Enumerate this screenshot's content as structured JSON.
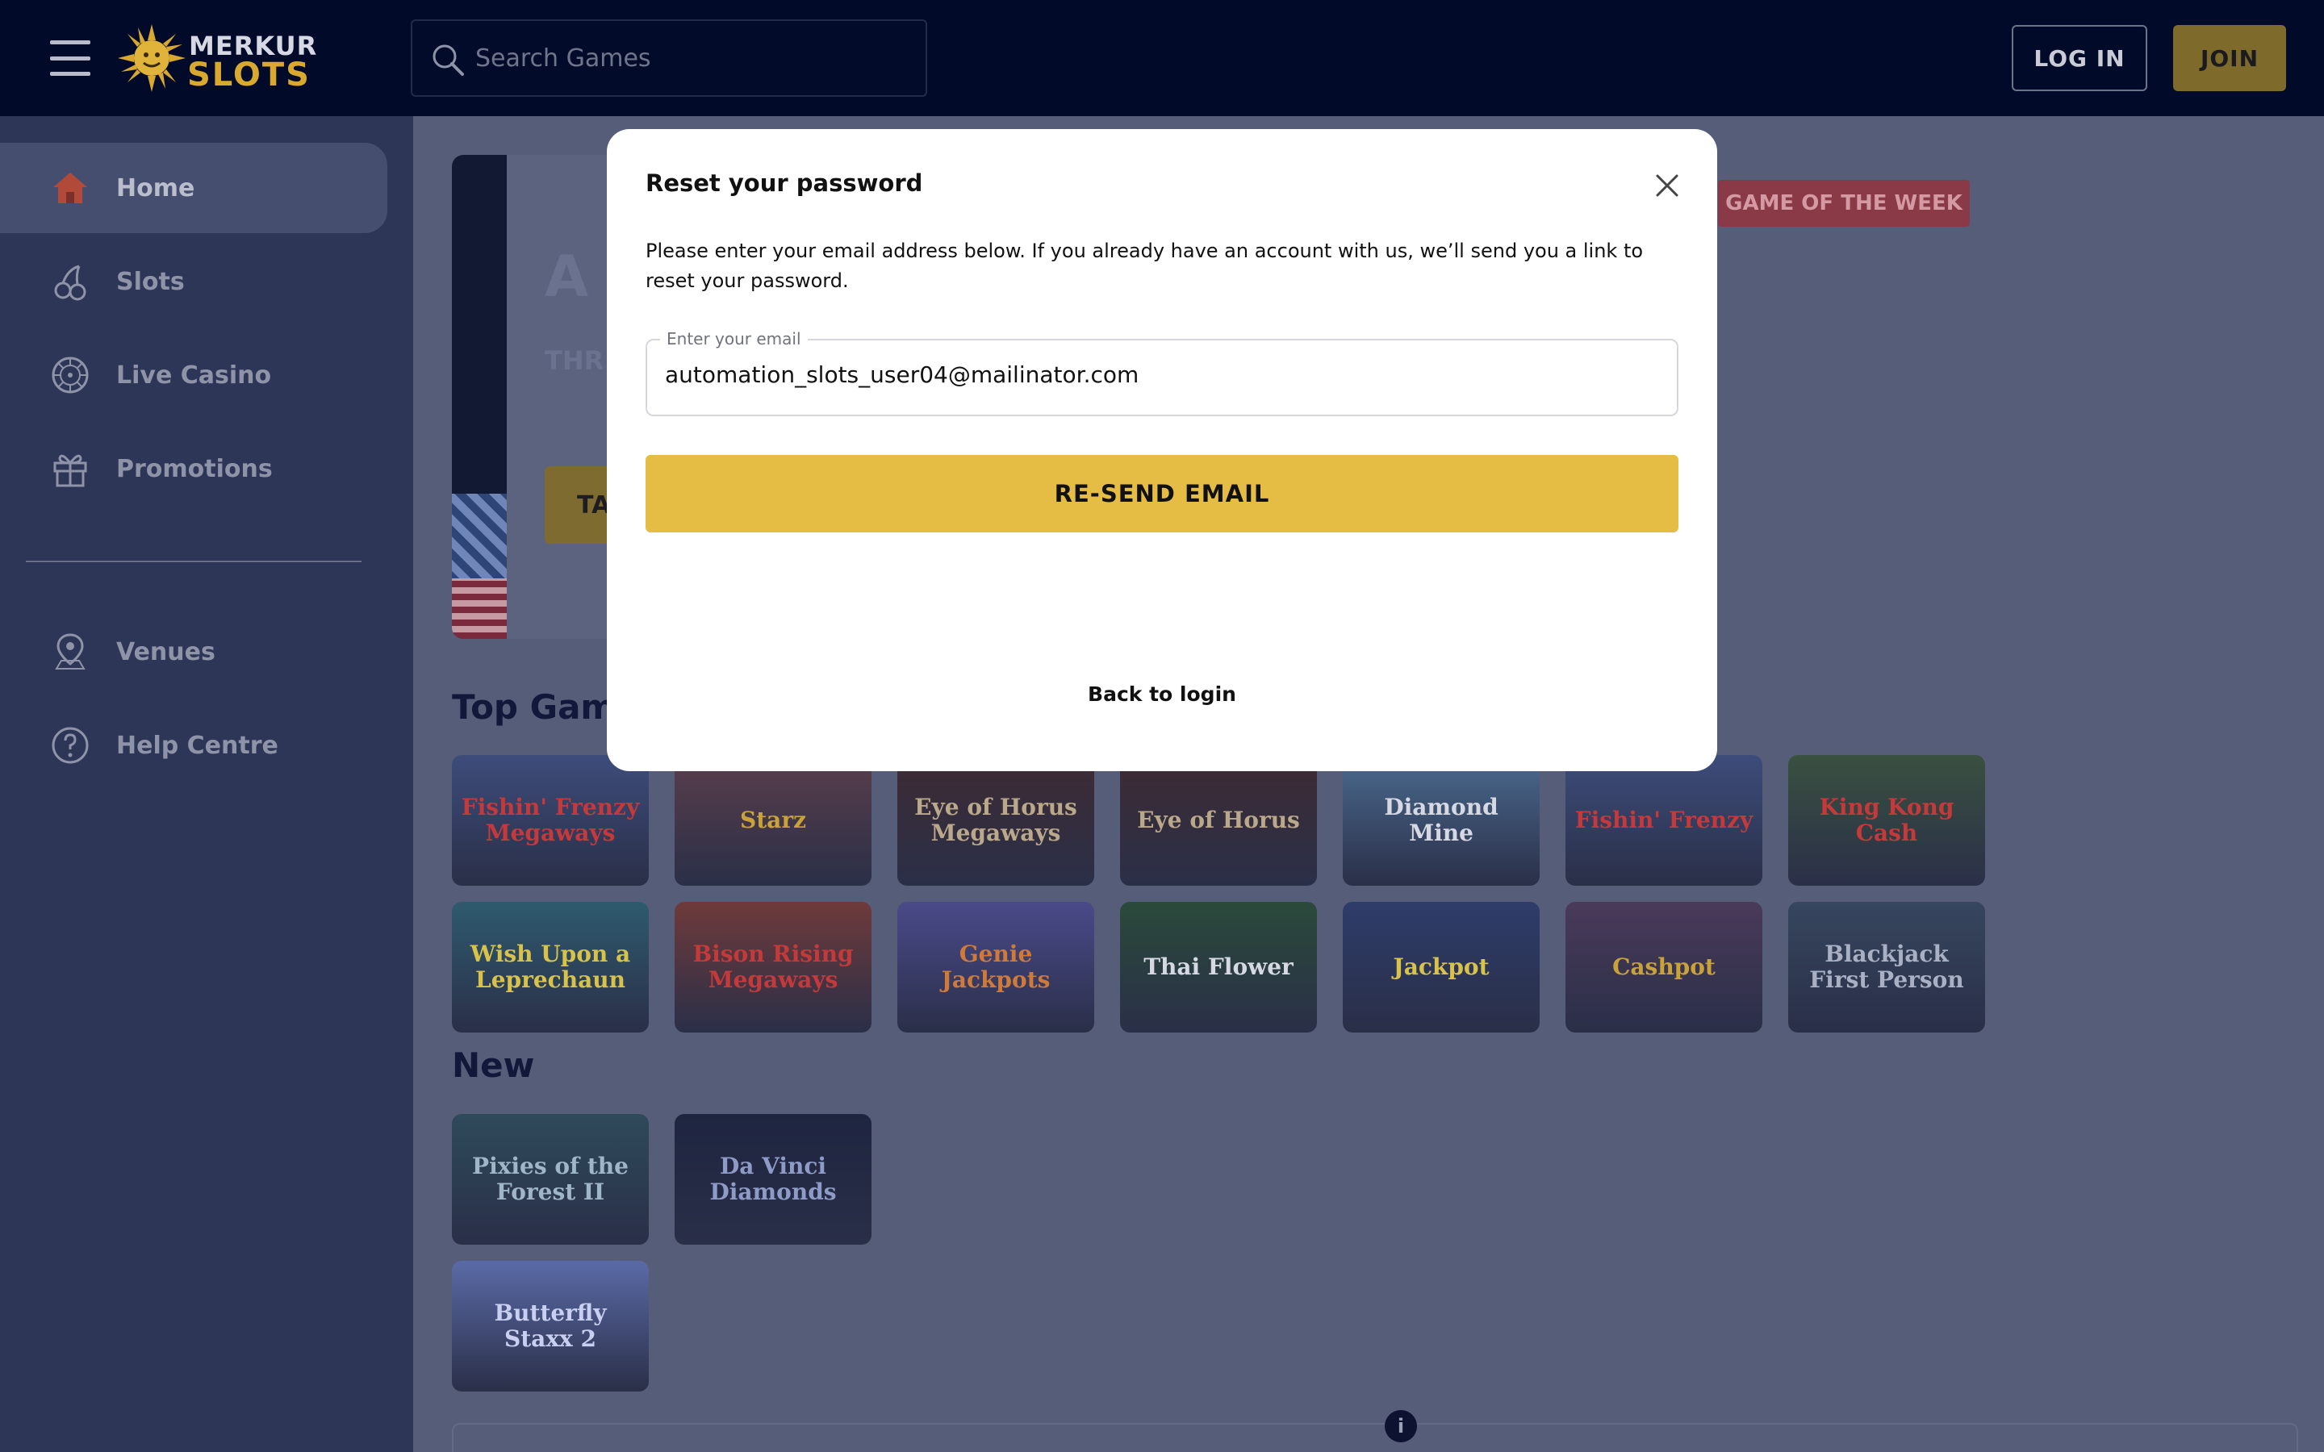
{
  "header": {
    "logo_line1": "MERKUR",
    "logo_line2": "SLOTS",
    "search_placeholder": "Search Games",
    "login_label": "LOG IN",
    "join_label": "JOIN"
  },
  "sidebar": {
    "items": [
      {
        "label": "Home",
        "icon": "home-icon",
        "active": true
      },
      {
        "label": "Slots",
        "icon": "cherry-icon"
      },
      {
        "label": "Live Casino",
        "icon": "roulette-wheel-icon"
      },
      {
        "label": "Promotions",
        "icon": "gift-icon"
      },
      {
        "label": "Venues",
        "icon": "map-pin-icon"
      },
      {
        "label": "Help Centre",
        "icon": "question-circle-icon"
      }
    ]
  },
  "banner": {
    "title_fragment": "A",
    "subtitle_fragment": "THR",
    "cta_fragment": "TA",
    "badge": "GAME OF THE WEEK"
  },
  "sections": {
    "top_games_title": "Top Game",
    "new_title": "New"
  },
  "top_games": [
    {
      "name": "Fishin' Frenzy Megaways",
      "color": "#3d4c7a",
      "text_color": "#c43a3a"
    },
    {
      "name": "Starz",
      "color": "#5a3e4a",
      "text_color": "#c9a23a"
    },
    {
      "name": "Eye of Horus Megaways",
      "color": "#3e2b33",
      "text_color": "#b9a98a"
    },
    {
      "name": "Eye of Horus",
      "color": "#3e2b33",
      "text_color": "#b9a98a"
    },
    {
      "name": "Diamond Mine",
      "color": "#4a6a8e",
      "text_color": "#d6d9e3"
    },
    {
      "name": "Fishin' Frenzy",
      "color": "#3d4c7a",
      "text_color": "#c43a3a"
    },
    {
      "name": "King Kong Cash",
      "color": "#3a5040",
      "text_color": "#c43a3a"
    },
    {
      "name": "Wish Upon a Leprechaun",
      "color": "#2e5a6e",
      "text_color": "#d8c24a"
    },
    {
      "name": "Bison Rising Megaways",
      "color": "#6e3a3a",
      "text_color": "#c43a3a"
    },
    {
      "name": "Genie Jackpots",
      "color": "#4a4a8a",
      "text_color": "#d07a3a"
    },
    {
      "name": "Thai Flower",
      "color": "#2a4a3a",
      "text_color": "#d6d9e3"
    },
    {
      "name": "Jackpot",
      "color": "#2e3c6a",
      "text_color": "#d8c24a"
    },
    {
      "name": "Cashpot",
      "color": "#4a3a5a",
      "text_color": "#c9a23a"
    },
    {
      "name": "Blackjack First Person",
      "color": "#36465e",
      "text_color": "#a9b0c4"
    }
  ],
  "new_games": [
    {
      "name": "Pixies of the Forest II",
      "color": "#2e4a5a",
      "text_color": "#9fb6c6"
    },
    {
      "name": "Da Vinci Diamonds",
      "color": "#1e2540",
      "text_color": "#8e9bc6"
    },
    {
      "name": "Butterfly Staxx 2",
      "color": "#5a6aa6",
      "text_color": "#c9cff0"
    }
  ],
  "modal": {
    "title": "Reset your password",
    "description": "Please enter your email address below. If you already have an account with us, we’ll send you a link to reset your password.",
    "email_label": "Enter your email",
    "email_value": "automation_slots_user04@mailinator.com",
    "resend_label": "RE-SEND EMAIL",
    "back_label": "Back to login"
  },
  "colors": {
    "header_bg": "#020a29",
    "sidebar_bg": "#2e3658",
    "accent_yellow": "#e5bd44",
    "badge_red": "#8a3a47"
  }
}
